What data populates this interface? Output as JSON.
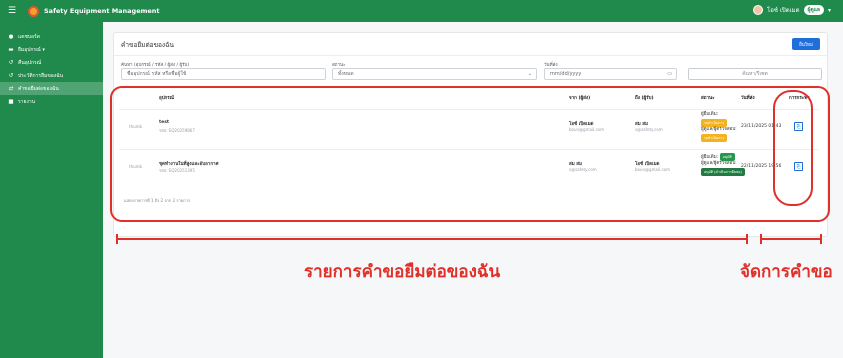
{
  "topbar": {
    "menu_icon": "hamburger-icon",
    "brand": "Safety Equipment Management",
    "user_name": "โอซ์ เปิดเมด",
    "user_badge": "ผู้ดูแล"
  },
  "sidebar": {
    "items": [
      {
        "icon": "dashboard-icon",
        "label": "แดชบอร์ด"
      },
      {
        "icon": "equipment-icon",
        "label": "ยืมอุปกรณ์ ▾"
      },
      {
        "icon": "return-icon",
        "label": "คืนอุปกรณ์"
      },
      {
        "icon": "history-icon",
        "label": "ประวัติการยืมของฉัน"
      },
      {
        "icon": "request-icon",
        "label": "คำขอยืมต่อของฉัน"
      },
      {
        "icon": "report-icon",
        "label": "รายงาน"
      }
    ]
  },
  "page": {
    "title": "คำขอยืมต่อของฉัน",
    "new_button": "ยื่นใหม่"
  },
  "filters": {
    "search_label": "ค้นหา (อุปกรณ์ / รหัส / ผู้ส่ง / ผู้รับ)",
    "search_placeholder": "ชื่ออุปกรณ์ รหัส หรือชื่อผู้ใช้",
    "status_label": "สถานะ",
    "status_value": "ทั้งหมด",
    "date_label": "วันที่ส่ง",
    "date_placeholder": "mm/dd/yyyy",
    "search_button": "ค้นหา/รีเซต"
  },
  "table": {
    "headers": [
      "อุปกรณ์",
      "จาก (ผู้ส่ง)",
      "ถึง (ผู้รับ)",
      "สถานะ",
      "วันที่ส่ง",
      "การกระทำ"
    ],
    "rows": [
      {
        "thumb": "thumb",
        "name": "test",
        "code": "รหัส: EQ20259867",
        "from_name": "โอซ์ เปิดเมด",
        "from_email": "boun@gmail.com",
        "to_name": "สม สม",
        "to_email": "s@safety.com",
        "status_lines": [
          "ผู้ยืมเดิม:",
          "รอดำเนินการ",
          "ผู้ดูแล/ผู้ตรวจสอบ:",
          "รอดำเนินการ"
        ],
        "date": "23/11/2025 01:43",
        "action_label": "ดู"
      },
      {
        "thumb": "thumb",
        "name": "ชุดทำงานในที่สูงและอับอากาศ",
        "code": "รหัส: EQ20251395",
        "from_name": "สม สม",
        "from_email": "s@safety.com",
        "to_name": "โอซ์ เปิดเมด",
        "to_email": "boun@gmail.com",
        "status_lines": [
          "ผู้ยืมเดิม:",
          "อนุมัติ",
          "ผู้ดูแล/ผู้ตรวจสอบ:",
          "อนุมัติ (ดำเนินการยืมต่อ)"
        ],
        "date": "22/11/2025 19:56",
        "action_label": "ดู"
      }
    ],
    "footer": "แสดงรายการที่ 1 ถึง 2 จาก 2 รายการ"
  },
  "annotations": {
    "left_label": "รายการคำขอยืมต่อของฉัน",
    "right_label": "จัดการคำขอ"
  },
  "colors": {
    "brand_green": "#1f8a4c",
    "accent_blue": "#1e6fd9",
    "annotation_red": "#e0302a"
  }
}
